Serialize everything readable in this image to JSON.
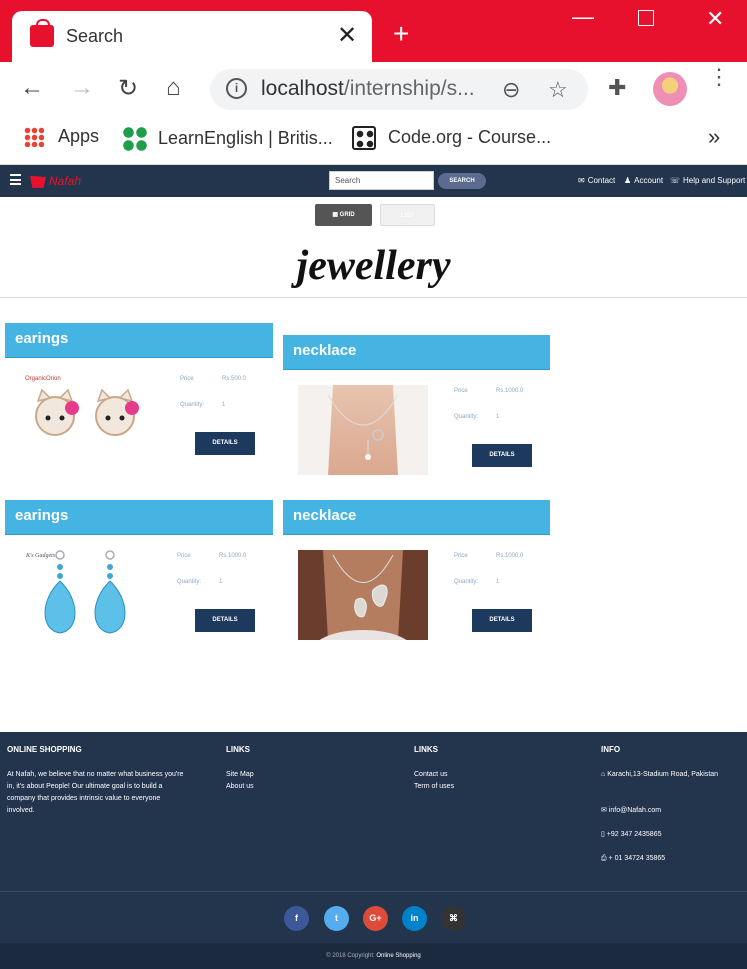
{
  "browser": {
    "tab_title": "Search",
    "new_tab": "+",
    "address_host": "localhost",
    "address_path": "/internship/s...",
    "bookmarks": [
      {
        "label": "Apps"
      },
      {
        "label": "LearnEnglish | Britis..."
      },
      {
        "label": "Code.org - Course..."
      }
    ],
    "bookmarks_more": "»"
  },
  "site": {
    "logo": "Nafah",
    "search_placeholder": "Search",
    "search_button": "SEARCH",
    "nav": {
      "contact": "Contact",
      "account": "Account",
      "help": "Help and Support"
    },
    "view": {
      "grid": "GRID",
      "list": "LIST"
    },
    "category_title": "jewellery"
  },
  "products": [
    {
      "name": "earings",
      "price_label": "Price",
      "price": "Rs.500.0",
      "qty_label": "Quantity:",
      "qty": "1",
      "button": "DETAILS"
    },
    {
      "name": "necklace",
      "price_label": "Price",
      "price": "Rs.1000.0",
      "qty_label": "Quantity:",
      "qty": "1",
      "button": "DETAILS"
    },
    {
      "name": "earings",
      "price_label": "Price",
      "price": "Rs.1000.0",
      "qty_label": "Quantity:",
      "qty": "1",
      "button": "DETAILS"
    },
    {
      "name": "necklace",
      "price_label": "Price",
      "price": "Rs.1000.0",
      "qty_label": "Quantity:",
      "qty": "1",
      "button": "DETAILS"
    }
  ],
  "footer": {
    "about_heading": "ONLINE SHOPPING",
    "about_text": "At Nafah, we believe that no matter what business you're in, it's about People! Our ultimate goal is to build a company that provides intrinsic value to everyone involved.",
    "links1_heading": "LINKS",
    "links1": [
      "Site Map",
      "About us"
    ],
    "links2_heading": "LINKS",
    "links2": [
      "Contact us",
      "Term of uses"
    ],
    "info_heading": "INFO",
    "address": "Karachi,13-Stadium Road, Pakistan",
    "email": "info@Nafah.com",
    "phone": "+92 347 2435865",
    "fax": "+ 01 34724 35865",
    "copyright_prefix": "© 2018 Copyright:",
    "copyright_name": "Online Shopping"
  },
  "colors": {
    "brand_red": "#e8112d",
    "nav_bg": "#23344d",
    "card_head": "#45b4e3",
    "button": "#1d3a5e"
  }
}
